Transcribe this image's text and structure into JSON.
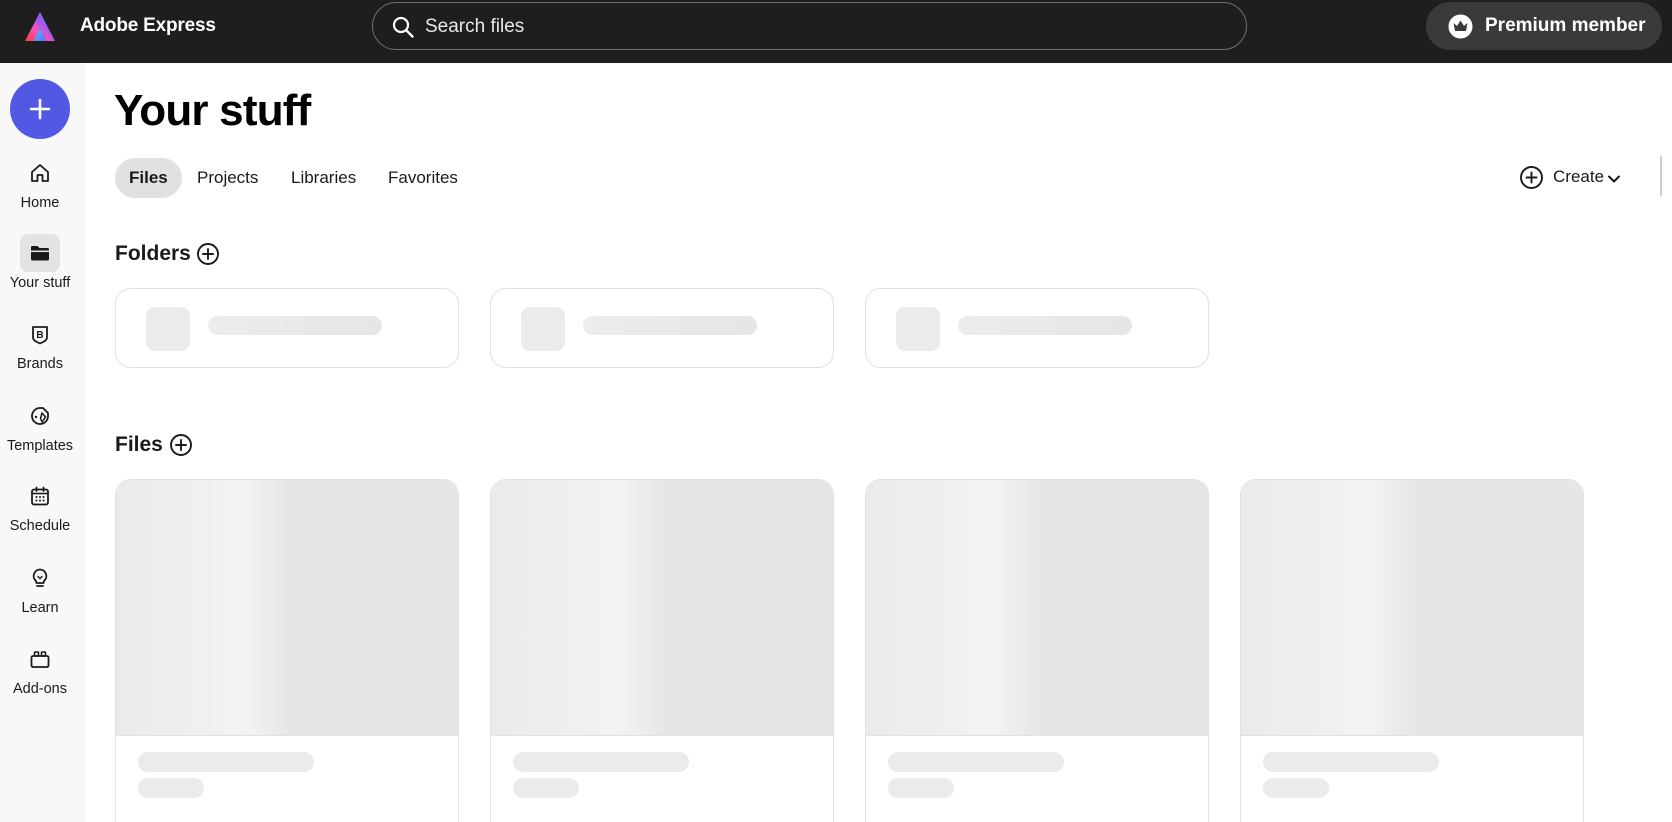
{
  "app": {
    "name": "Adobe Express"
  },
  "search": {
    "placeholder": "Search files"
  },
  "account": {
    "premium_label": "Premium member"
  },
  "rail": {
    "items": [
      {
        "label": "Home",
        "icon": "home-icon"
      },
      {
        "label": "Your stuff",
        "icon": "folder-icon",
        "active": true
      },
      {
        "label": "Brands",
        "icon": "brand-icon"
      },
      {
        "label": "Templates",
        "icon": "templates-icon"
      },
      {
        "label": "Schedule",
        "icon": "calendar-icon"
      },
      {
        "label": "Learn",
        "icon": "lightbulb-icon"
      },
      {
        "label": "Add-ons",
        "icon": "addons-icon"
      }
    ]
  },
  "main": {
    "title": "Your stuff",
    "tabs": [
      {
        "label": "Files",
        "active": true
      },
      {
        "label": "Projects"
      },
      {
        "label": "Libraries"
      },
      {
        "label": "Favorites"
      }
    ],
    "create_label": "Create",
    "folders_heading": "Folders",
    "files_heading": "Files"
  },
  "colors": {
    "topbar": "#1e1e1e",
    "accent": "#5258e4",
    "placeholder": "#ebebeb"
  }
}
